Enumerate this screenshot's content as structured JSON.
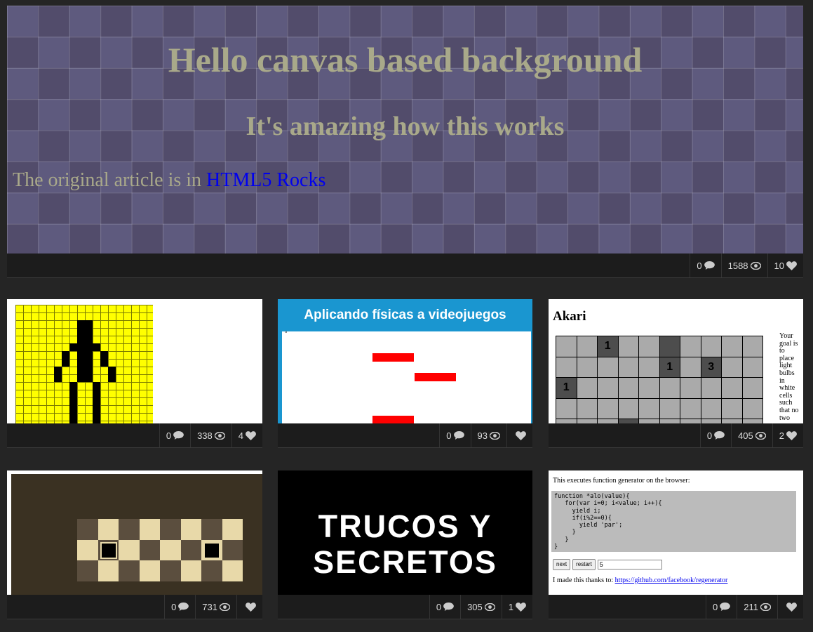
{
  "hero": {
    "title": "Hello canvas based background",
    "subtitle": "It's amazing how this works",
    "text": "The original article is in ",
    "link": "HTML5 Rocks",
    "stats": {
      "comments": "0",
      "views": "1588",
      "likes": "10"
    }
  },
  "cards": [
    {
      "stats": {
        "comments": "0",
        "views": "338",
        "likes": "4"
      }
    },
    {
      "title": "Aplicando físicas a videojuegos",
      "canvas_mark": "°",
      "stats": {
        "comments": "0",
        "views": "93",
        "likes": ""
      }
    },
    {
      "title": "Akari",
      "cells": [
        "",
        "",
        "1",
        "",
        "",
        "#",
        "",
        "",
        "",
        "",
        "",
        "",
        "",
        "",
        "",
        "1",
        "",
        "3",
        "",
        "",
        "1",
        "",
        "",
        "",
        "",
        "",
        "",
        "",
        "",
        "",
        "",
        "",
        "",
        "",
        "",
        "",
        "",
        "",
        "",
        "",
        "",
        "",
        "",
        "#",
        "",
        "",
        "",
        "",
        "",
        ""
      ],
      "side_text": "Your goal is to place light bulbs in white cells such that no two",
      "stats": {
        "comments": "0",
        "views": "405",
        "likes": "2"
      }
    },
    {
      "stats": {
        "comments": "0",
        "views": "731",
        "likes": ""
      }
    },
    {
      "line1": "TRUCOS Y",
      "line2": "SECRETOS",
      "stats": {
        "comments": "0",
        "views": "305",
        "likes": "1"
      }
    },
    {
      "intro": "This executes function generator on the browser:",
      "code": "function *alo(value){\n   for(var i=0; i<value; i++){\n     yield i;\n     if(i%2==0){\n       yield 'par';\n     }\n   }\n}",
      "btn_next": "next",
      "btn_restart": "restart",
      "input_value": "5",
      "foot_text": "I made this thanks to: ",
      "foot_link": "https://github.com/facebook/regenerator",
      "stats": {
        "comments": "0",
        "views": "211",
        "likes": ""
      }
    }
  ],
  "colors": {
    "page_bg": "#252525",
    "footer_bg": "#1c1c1c",
    "hero_text": "#a9a98a",
    "link": "#0000ee",
    "physics_header": "#1a96d0",
    "bar": "#ff0000",
    "pixel_yellow": "#ffff00",
    "checker_dark": "#5b4e3e",
    "checker_light": "#e8d9a9",
    "checker_bg": "#3a3122"
  },
  "icons": {
    "comments": "comment-bubble-icon",
    "views": "eye-icon",
    "likes": "heart-icon"
  }
}
